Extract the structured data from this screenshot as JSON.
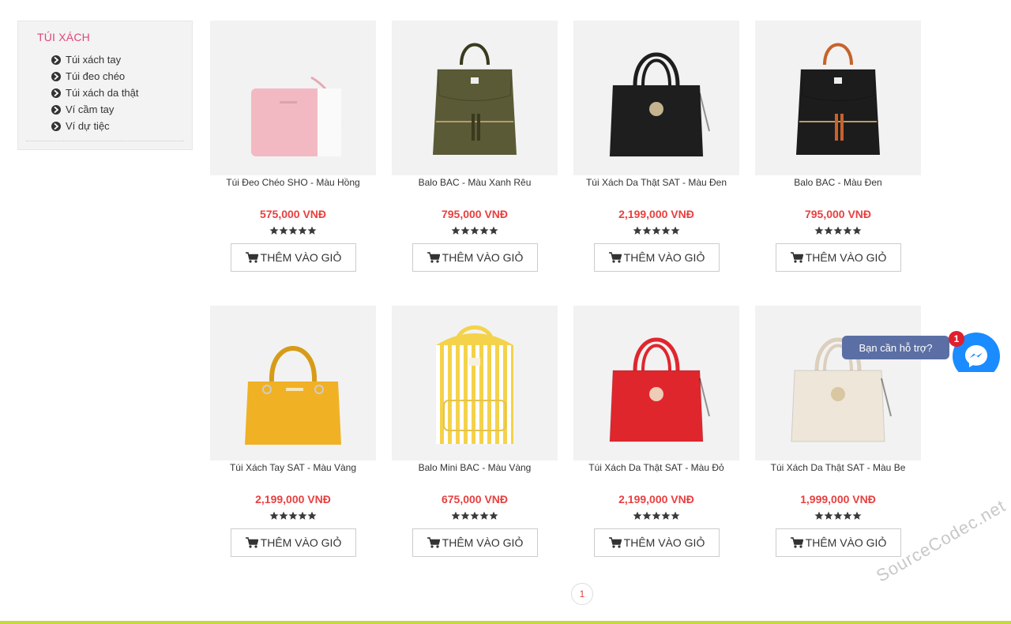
{
  "sidebar": {
    "title": "TÚI XÁCH",
    "items": [
      {
        "label": "Túi xách tay"
      },
      {
        "label": "Túi đeo chéo"
      },
      {
        "label": "Túi xách da thật"
      },
      {
        "label": "Ví cầm tay"
      },
      {
        "label": "Ví dự tiệc"
      }
    ]
  },
  "products": [
    {
      "name": "Túi Đeo Chéo SHO - Màu Hồng",
      "price": "575,000 VNĐ",
      "rating": 5,
      "button": "THÊM VÀO GIỎ",
      "color": "#f3b9c3",
      "style": "crossbody"
    },
    {
      "name": "Balo BAC - Màu Xanh Rêu",
      "price": "795,000 VNĐ",
      "rating": 5,
      "button": "THÊM VÀO GIỎ",
      "color": "#5a5a36",
      "style": "backpack"
    },
    {
      "name": "Túi Xách Da Thật SAT - Màu Đen",
      "price": "2,199,000 VNĐ",
      "rating": 5,
      "button": "THÊM VÀO GIỎ",
      "color": "#1e1e1e",
      "style": "tote"
    },
    {
      "name": "Balo BAC - Màu Đen",
      "price": "795,000 VNĐ",
      "rating": 5,
      "button": "THÊM VÀO GIỎ",
      "color": "#1c1c1c",
      "style": "backpack"
    },
    {
      "name": "Túi Xách Tay SAT - Màu Vàng",
      "price": "2,199,000 VNĐ",
      "rating": 5,
      "button": "THÊM VÀO GIỎ",
      "color": "#f0b125",
      "style": "handbag"
    },
    {
      "name": "Balo Mini BAC - Màu Vàng",
      "price": "675,000 VNĐ",
      "rating": 5,
      "button": "THÊM VÀO GIỎ",
      "color": "#f4d24a",
      "style": "mini"
    },
    {
      "name": "Túi Xách Da Thật SAT - Màu Đỏ",
      "price": "2,199,000 VNĐ",
      "rating": 5,
      "button": "THÊM VÀO GIỎ",
      "color": "#e0262d",
      "style": "tote"
    },
    {
      "name": "Túi Xách Da Thật SAT - Màu Be",
      "price": "1,999,000 VNĐ",
      "rating": 5,
      "button": "THÊM VÀO GIỎ",
      "color": "#efe6da",
      "style": "tote2"
    }
  ],
  "pagination": {
    "current": "1"
  },
  "messenger": {
    "prompt": "Bạn cần hỗ trợ?",
    "badge": "1"
  },
  "watermark": "SourceCodec.net",
  "colors": {
    "accent_pink": "#e0457b",
    "price_red": "#e84040",
    "messenger_blue": "#1a8cff",
    "footer_line": "#c5d93a"
  }
}
